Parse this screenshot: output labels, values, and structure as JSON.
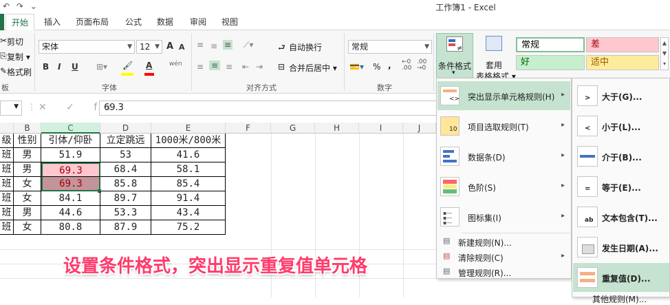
{
  "window": {
    "title": "工作簿1 - Excel",
    "qat": "↶ ↷ ⌄"
  },
  "tabs": [
    "开始",
    "插入",
    "页面布局",
    "公式",
    "数据",
    "审阅",
    "视图"
  ],
  "clipboard": {
    "cut": "剪切",
    "copy": "复制 ▾",
    "format_painter": "格式刷",
    "label": "板"
  },
  "font": {
    "name": "宋体",
    "size": "12",
    "grow": "A",
    "shrink": "A",
    "bold": "B",
    "italic": "I",
    "underline": "U",
    "phonetic": "wén",
    "label": "字体"
  },
  "alignment": {
    "wrap": "自动换行",
    "merge": "合并后居中 ▾",
    "label": "对齐方式"
  },
  "number": {
    "format": "常规",
    "percent": "%",
    "comma": ",",
    "label": "数字"
  },
  "styles": {
    "conditional_format": "条件格式",
    "conditional_format_arrow": "▾",
    "table_format": "套用",
    "table_format2": "表格格式 ▾",
    "cells": [
      {
        "label": "常规",
        "bg": "#ffffff",
        "fg": "#000000"
      },
      {
        "label": "差",
        "bg": "#ffc7ce",
        "fg": "#9c0006"
      },
      {
        "label": "好",
        "bg": "#c6efce",
        "fg": "#006100"
      },
      {
        "label": "适中",
        "bg": "#ffeb9c",
        "fg": "#9c5700"
      }
    ]
  },
  "formula_bar": {
    "value": "69.3",
    "fx": "✕ ✓ fx"
  },
  "sheet": {
    "columns": [
      "B",
      "C",
      "D",
      "E",
      "F",
      "G",
      "H",
      "I",
      "J"
    ],
    "header_row": [
      "级",
      "性别",
      "引体/仰卧",
      "立定跳远",
      "1000米/800米"
    ],
    "rows": [
      [
        "班",
        "男",
        "51.9",
        "53",
        "41.6"
      ],
      [
        "班",
        "男",
        "69.3",
        "68.4",
        "58.1"
      ],
      [
        "班",
        "女",
        "69.3",
        "85.8",
        "85.4"
      ],
      [
        "班",
        "女",
        "84.1",
        "89.7",
        "91.4"
      ],
      [
        "班",
        "男",
        "44.6",
        "53.3",
        "43.4"
      ],
      [
        "班",
        "女",
        "80.8",
        "87.9",
        "75.2"
      ]
    ]
  },
  "cf_menu": [
    {
      "label": "突出显示单元格规则(H)",
      "icon": "highlight-rules-icon",
      "sub": true
    },
    {
      "label": "项目选取规则(T)",
      "icon": "top-bottom-icon",
      "sub": true
    },
    {
      "label": "数据条(D)",
      "icon": "data-bars-icon",
      "sub": true
    },
    {
      "label": "色阶(S)",
      "icon": "color-scales-icon",
      "sub": true
    },
    {
      "label": "图标集(I)",
      "icon": "icon-sets-icon",
      "sub": true
    },
    {
      "label": "新建规则(N)...",
      "icon": "new-rule-icon",
      "sub": false
    },
    {
      "label": "清除规则(C)",
      "icon": "clear-rules-icon",
      "sub": true
    },
    {
      "label": "管理规则(R)...",
      "icon": "manage-rules-icon",
      "sub": false
    }
  ],
  "sub_menu": [
    {
      "label": "大于(G)...",
      "icon": "greater-than-icon"
    },
    {
      "label": "小于(L)...",
      "icon": "less-than-icon"
    },
    {
      "label": "介于(B)...",
      "icon": "between-icon"
    },
    {
      "label": "等于(E)...",
      "icon": "equal-to-icon"
    },
    {
      "label": "文本包含(T)...",
      "icon": "text-contains-icon"
    },
    {
      "label": "发生日期(A)...",
      "icon": "date-occurring-icon"
    },
    {
      "label": "重复值(D)...",
      "icon": "duplicate-values-icon"
    },
    {
      "label": "其他规则(M)...",
      "icon": "more-rules-icon"
    }
  ],
  "caption": "设置条件格式，突出显示重复值单元格"
}
